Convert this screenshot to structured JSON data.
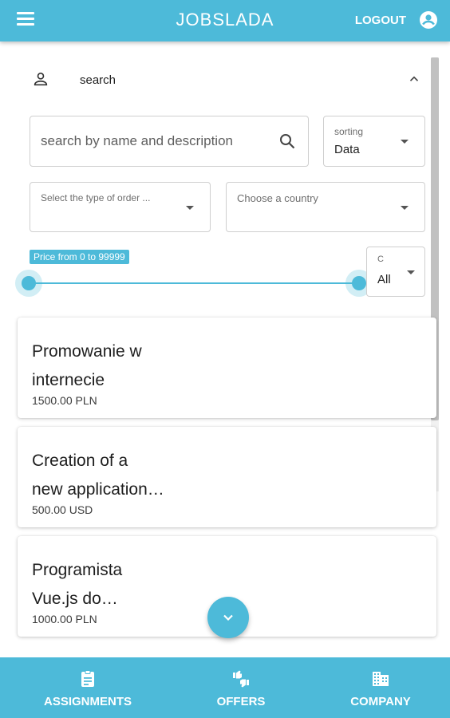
{
  "header": {
    "title": "JOBSLADA",
    "logout_label": "LOGOUT"
  },
  "search_panel": {
    "label": "search",
    "search_input": {
      "placeholder": "search by name and description"
    },
    "sorting": {
      "label": "sorting",
      "value": "Data"
    },
    "order_type": {
      "placeholder": "Select the type of order ..."
    },
    "country": {
      "placeholder": "Choose a country"
    },
    "price": {
      "label": "Price from 0 to 99999",
      "min": 0,
      "max": 99999,
      "range_fraction_start": 0,
      "range_fraction_end": 1
    },
    "currency": {
      "label": "C",
      "value": "All"
    }
  },
  "offers": [
    {
      "title_line1": "Promowanie w",
      "title_line2": "internecie",
      "price": "1500.00 PLN"
    },
    {
      "title_line1": "Creation of a",
      "title_line2": "new application…",
      "price": "500.00 USD"
    },
    {
      "title_line1": "Programista",
      "title_line2": "Vue.js do…",
      "price": "1000.00 PLN"
    }
  ],
  "bottom_nav": [
    {
      "label": "ASSIGNMENTS",
      "icon": "clipboard-icon"
    },
    {
      "label": "OFFERS",
      "icon": "thumbs-icon"
    },
    {
      "label": "COMPANY",
      "icon": "building-icon"
    }
  ],
  "colors": {
    "primary": "#4dbad9",
    "text": "#212121"
  }
}
